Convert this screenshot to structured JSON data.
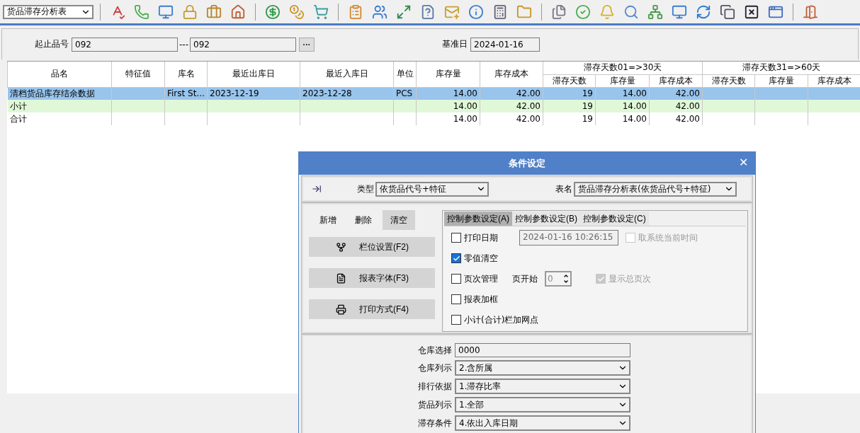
{
  "report_selector": {
    "value": "货品滞存分析表"
  },
  "filter": {
    "range_label": "起止品号",
    "from": "092",
    "separator": "---",
    "to": "092",
    "browse": "···",
    "base_date_label": "基准日",
    "base_date": "2024-01-16"
  },
  "table": {
    "columns": [
      "品名",
      "特征值",
      "库名",
      "最近出库日",
      "最近入库日",
      "单位",
      "库存量",
      "库存成本"
    ],
    "groups": [
      {
        "label": "滞存天数01=>30天",
        "columns": [
          "滞存天数",
          "库存量",
          "库存成本"
        ]
      },
      {
        "label": "滞存天数31=>60天",
        "columns": [
          "滞存天数",
          "库存量",
          "库存成本"
        ]
      }
    ],
    "rows": [
      {
        "kind": "detail",
        "selected": true,
        "cells": [
          "清档货品库存结余数据",
          null,
          "First St...",
          "2023-12-19",
          "2023-12-28",
          "PCS",
          "14.00",
          "42.00",
          "19",
          "14.00",
          "42.00",
          null,
          null,
          null
        ]
      },
      {
        "kind": "subtotal",
        "selected": false,
        "cells": [
          "小计",
          null,
          null,
          null,
          null,
          null,
          "14.00",
          "42.00",
          "19",
          "14.00",
          "42.00",
          null,
          null,
          null
        ]
      },
      {
        "kind": "total",
        "selected": false,
        "cells": [
          "合计",
          null,
          null,
          null,
          null,
          null,
          "14.00",
          "42.00",
          "19",
          "14.00",
          "42.00",
          null,
          null,
          null
        ]
      }
    ]
  },
  "dialog": {
    "title": "条件设定",
    "close": "✕",
    "type_label": "类型",
    "type_value": "依货品代号+特征",
    "name_label": "表名",
    "name_value": "货品滞存分析表(依货品代号+特征)",
    "actions": [
      {
        "label": "新增",
        "selected": false
      },
      {
        "label": "删除",
        "selected": false
      },
      {
        "label": "清空",
        "selected": true
      }
    ],
    "side_buttons": [
      {
        "label": "栏位设置(F2)"
      },
      {
        "label": "报表字体(F3)"
      },
      {
        "label": "打印方式(F4)"
      }
    ],
    "tabs": [
      {
        "label": "控制参数设定(A)",
        "selected": true
      },
      {
        "label": "控制参数设定(B)",
        "selected": false
      },
      {
        "label": "控制参数设定(C)",
        "selected": false
      }
    ],
    "option_rows": [
      [
        {
          "kind": "checkbox",
          "label": "打印日期",
          "checked": false,
          "disabled": false
        },
        {
          "kind": "field",
          "value": "2024-01-16 10:26:15",
          "disabled": true
        },
        {
          "kind": "checkbox",
          "label": "取系统当前时间",
          "checked": false,
          "disabled": true
        }
      ],
      [
        {
          "kind": "checkbox",
          "label": "零值清空",
          "checked": true,
          "disabled": false
        }
      ],
      [
        {
          "kind": "checkbox",
          "label": "页次管理",
          "checked": false,
          "disabled": false
        },
        {
          "kind": "spinner",
          "label": "页开始",
          "value": "0",
          "disabled": true
        },
        {
          "kind": "checkbox",
          "label": "显示总页次",
          "checked": true,
          "disabled": true
        }
      ],
      [
        {
          "kind": "checkbox",
          "label": "报表加框",
          "checked": false,
          "disabled": false
        }
      ],
      [
        {
          "kind": "checkbox",
          "label": "小计(合计)栏加网点",
          "checked": false,
          "disabled": false
        }
      ]
    ],
    "params": [
      {
        "label": "仓库选择",
        "kind": "text",
        "value": "0000"
      },
      {
        "label": "仓库列示",
        "kind": "select",
        "value": "2.含所属"
      },
      {
        "label": "排行依据",
        "kind": "select",
        "value": "1.滞存比率"
      },
      {
        "label": "货品列示",
        "kind": "select",
        "value": "1.全部"
      },
      {
        "label": "滞存条件",
        "kind": "select",
        "value": "4.依出入库日期"
      }
    ]
  }
}
